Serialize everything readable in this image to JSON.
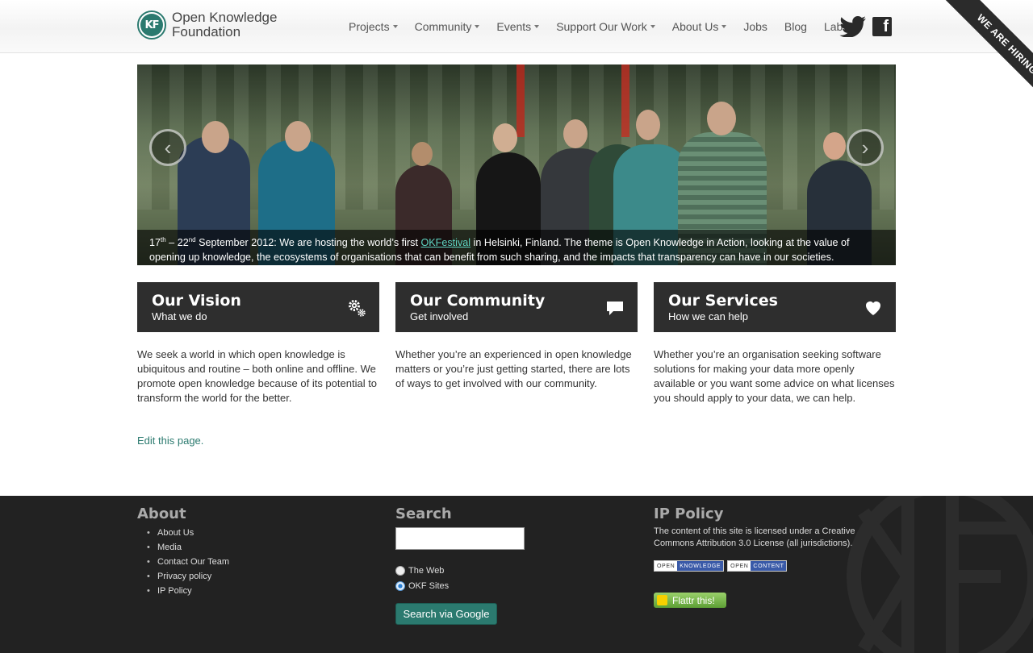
{
  "header": {
    "logo_line1": "Open Knowledge",
    "logo_line2": "Foundation",
    "logo_mark": "KF",
    "nav": [
      {
        "label": "Projects",
        "dropdown": true
      },
      {
        "label": "Community",
        "dropdown": true
      },
      {
        "label": "Events",
        "dropdown": true
      },
      {
        "label": "Support Our Work",
        "dropdown": true
      },
      {
        "label": "About Us",
        "dropdown": true
      },
      {
        "label": "Jobs",
        "dropdown": false
      },
      {
        "label": "Blog",
        "dropdown": false
      },
      {
        "label": "Labs",
        "dropdown": false
      }
    ],
    "ribbon": "WE ARE HIRING"
  },
  "hero": {
    "caption_date_a": "17",
    "caption_sup_a": "th",
    "caption_dash": " – 22",
    "caption_sup_b": "nd",
    "caption_part1": " September 2012: We are hosting the world’s first ",
    "caption_link": "OKFestival",
    "caption_part2": " in Helsinki, Finland. The theme is Open Knowledge in Action, looking at the value of opening up knowledge, the ecosystems of organisations that can benefit from such sharing, and the impacts that transparency can have in our societies.",
    "prev_arrow": "‹",
    "next_arrow": "›"
  },
  "features": [
    {
      "title": "Our Vision",
      "subtitle": "What we do",
      "icon": "gears-icon",
      "body": "We seek a world in which open knowledge is ubiquitous and routine – both online and offline. We promote open knowledge because of its potential to transform the world for the better."
    },
    {
      "title": "Our Community",
      "subtitle": "Get involved",
      "icon": "speech-bubble-icon",
      "body": "Whether you’re an experienced in open knowledge matters or you’re just getting started, there are lots of ways to get involved with our community."
    },
    {
      "title": "Our Services",
      "subtitle": "How we can help",
      "icon": "heart-icon",
      "body": "Whether you’re an organisation seeking software solutions for making your data more openly available or you want some advice on what licenses you should apply to your data, we can help."
    }
  ],
  "edit_link": "Edit this page.",
  "footer": {
    "about": {
      "heading": "About",
      "links": [
        "About Us",
        "Media",
        "Contact Our Team",
        "Privacy policy",
        "IP Policy"
      ]
    },
    "search": {
      "heading": "Search",
      "input_value": "",
      "option_web": "The Web",
      "option_okf": "OKF Sites",
      "selected": "OKF Sites",
      "button": "Search via Google"
    },
    "ip": {
      "heading": "IP Policy",
      "text": "The content of this site is licensed under a Creative Commons Attribution 3.0 License (all jurisdictions).",
      "badge1_a": "OPEN",
      "badge1_b": "KNOWLEDGE",
      "badge2_a": "OPEN",
      "badge2_b": "CONTENT",
      "flattr": "Flattr this!"
    }
  },
  "colors": {
    "accent": "#2b7a6f",
    "dark_panel": "#2e2e2e",
    "footer_bg": "#222222"
  }
}
